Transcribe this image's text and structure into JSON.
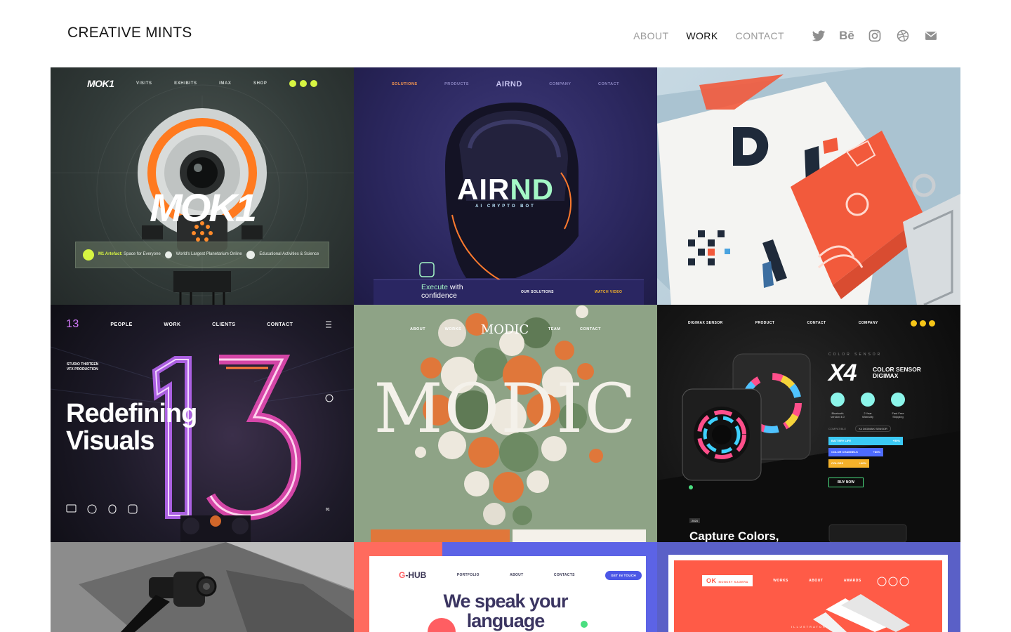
{
  "brand": {
    "name": "CREATIVE MINTS"
  },
  "nav": {
    "links": [
      {
        "label": "ABOUT",
        "active": false
      },
      {
        "label": "WORK",
        "active": true
      },
      {
        "label": "CONTACT",
        "active": false
      }
    ],
    "social": [
      {
        "name": "twitter-icon"
      },
      {
        "name": "behance-icon",
        "glyph": "Bē"
      },
      {
        "name": "instagram-icon"
      },
      {
        "name": "dribbble-icon"
      },
      {
        "name": "mail-icon"
      }
    ]
  },
  "colors": {
    "text_primary": "#111111",
    "text_muted": "#9a9a9a",
    "accent_lime": "#d7f542",
    "accent_orange": "#ff7a2e",
    "accent_mint": "#a4f7c6",
    "neon_pink": "#ff4fc3",
    "brand_red": "#f25a3c",
    "hub_blue": "#4c57e6"
  },
  "tiles": [
    {
      "id": "mok1",
      "nav": [
        "MOK1",
        "VISITS",
        "EXHIBITS",
        "IMAX",
        "SHOP"
      ],
      "title": "MOK1",
      "features": [
        {
          "bold": "M1 Artefact:",
          "text": "Space for Everyone"
        },
        {
          "bold": "",
          "text": "World's Largest Planetarium Online"
        },
        {
          "bold": "",
          "text": "Educational Activities & Science"
        }
      ]
    },
    {
      "id": "airnd",
      "nav": [
        "SOLUTIONS",
        "PRODUCTS",
        "AIRND",
        "COMPANY",
        "CONTACT"
      ],
      "title_a": "AIR",
      "title_b": "ND",
      "subtitle": "AI CRYPTO BOT",
      "tagline_accent": "Execute",
      "tagline_rest": "with",
      "tagline_line2": "confidence",
      "buttons": [
        "OUR SOLUTIONS",
        "WATCH VIDEO"
      ]
    },
    {
      "id": "brand-book"
    },
    {
      "id": "studio-13",
      "nav": [
        "13",
        "PEOPLE",
        "WORK",
        "CLIENTS",
        "CONTACT"
      ],
      "studio_line1": "STUDIO THIRTEEN",
      "studio_line2": "VFX PRODUCTION",
      "headline_1": "Redefining",
      "headline_2": "Visuals",
      "page_no": "01"
    },
    {
      "id": "modic",
      "nav": [
        "ABOUT",
        "WORKS",
        "MODIC",
        "TEAM",
        "CONTACT"
      ],
      "title": "MODIC"
    },
    {
      "id": "digimax",
      "nav": [
        "DIGIMAX SENSOR",
        "PRODUCT",
        "CONTACT",
        "COMPANY"
      ],
      "eyebrow": "COLOR SENSOR",
      "model": "X4",
      "product_line1": "COLOR SENSOR",
      "product_line2": "DIGIMAX",
      "features": [
        "Bluetooth version 4.0",
        "2 Year Warranty",
        "Fast Free Shipping"
      ],
      "compat_label": "COMPATIBLE",
      "compat_value": "X4 DIGIMAX SENSOR",
      "bars": [
        {
          "label": "BATTERY LIFE",
          "value": "+50%",
          "level": 1.0
        },
        {
          "label": "COLOR CHANNELS",
          "value": "+80%",
          "level": 0.74
        },
        {
          "label": "COLORS",
          "value": "+40%",
          "level": 0.55
        }
      ],
      "cta": "BUY NOW",
      "year": "2024",
      "headline": "Capture Colors,"
    },
    {
      "id": "binder"
    },
    {
      "id": "g-hub",
      "logo_g": "G",
      "logo_rest": "-HUB",
      "nav": [
        "PORTFOLIO",
        "ABOUT",
        "CONTACTS"
      ],
      "cta": "GET IN TOUCH",
      "headline_1": "We speak your",
      "headline_2": "language"
    },
    {
      "id": "ok-studio",
      "logo": "OK",
      "logo_small": "MONKEY KAGERA",
      "nav": [
        "WORKS",
        "ABOUT",
        "AWARDS"
      ],
      "caption": "ILLUSTRATOR"
    }
  ]
}
